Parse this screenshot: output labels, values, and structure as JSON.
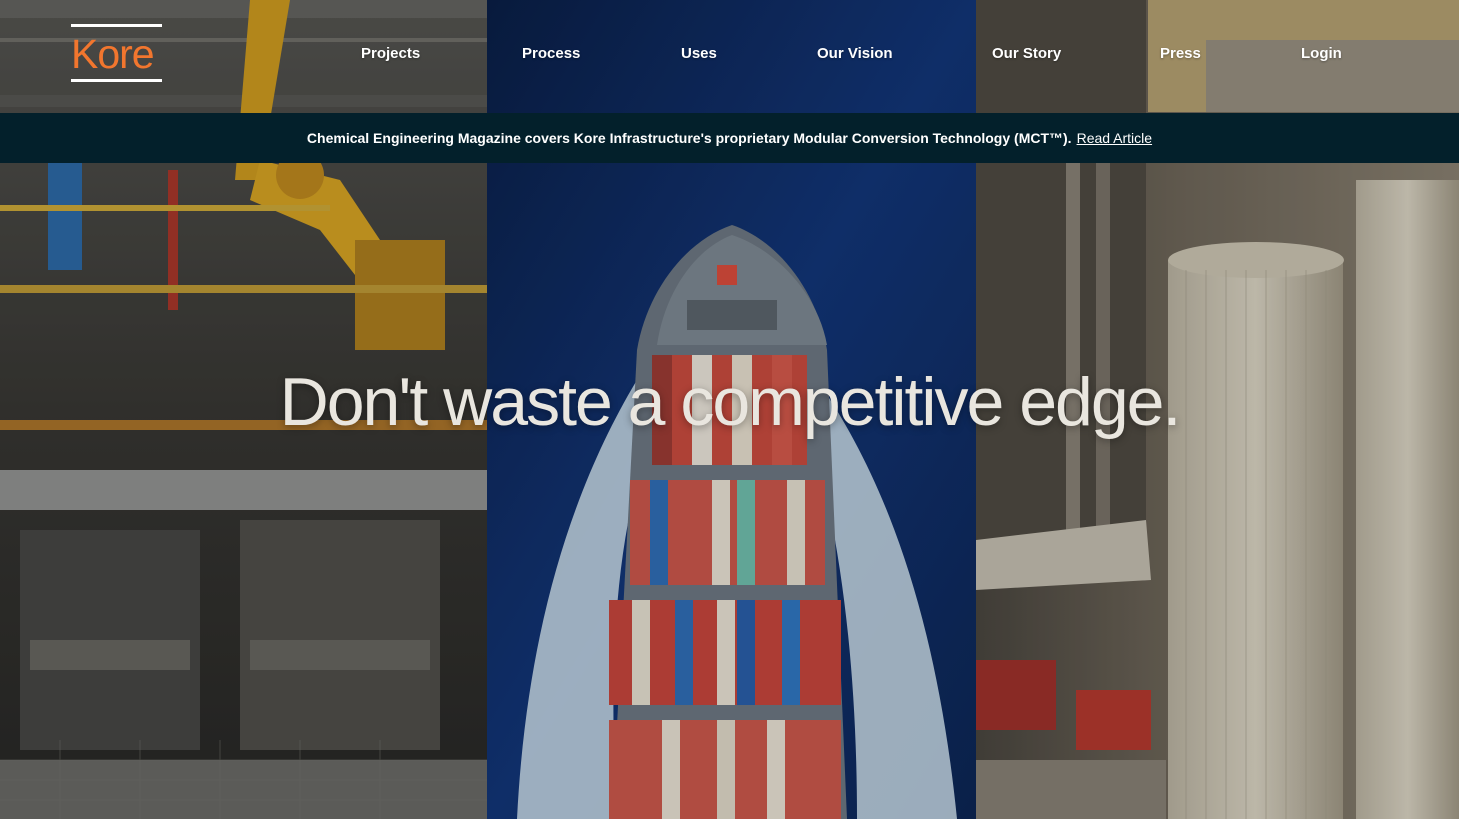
{
  "brand": {
    "logo_text": "Kore",
    "accent_color": "#f2762e"
  },
  "nav": {
    "items": [
      {
        "label": "Projects"
      },
      {
        "label": "Process"
      },
      {
        "label": "Uses"
      },
      {
        "label": "Our Vision"
      },
      {
        "label": "Our Story"
      },
      {
        "label": "Press"
      },
      {
        "label": "Login"
      }
    ]
  },
  "banner": {
    "text": "Chemical Engineering Magazine covers Kore Infrastructure's proprietary Modular Conversion Technology (MCT™).",
    "link_label": "Read Article",
    "background_color": "#03202b"
  },
  "hero": {
    "headline": "Don't waste a competitive edge."
  },
  "background_images": [
    {
      "subject": "industrial-robotic-machinery"
    },
    {
      "subject": "container-ship-aerial"
    },
    {
      "subject": "industrial-silo-plant"
    }
  ]
}
